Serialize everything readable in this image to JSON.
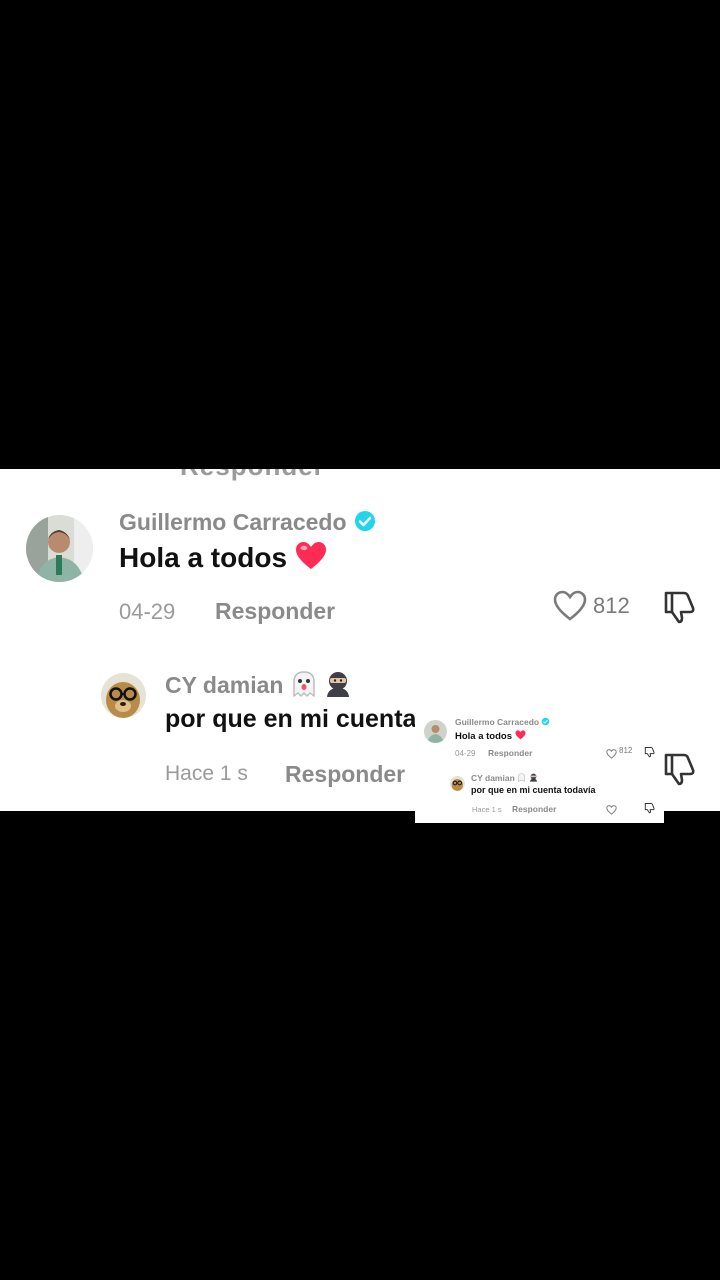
{
  "main": {
    "top_cut_text": "Responder",
    "comments": [
      {
        "username": "Guillermo Carracedo",
        "verified": true,
        "text": "Hola a todos",
        "text_emoji": "heart-icon",
        "date": "04-29",
        "reply_label": "Responder",
        "like_count": "812"
      },
      {
        "username": "CY damian",
        "name_emojis": [
          "ghost-icon",
          "ninja-icon"
        ],
        "text": "por que en mi cuenta todavía",
        "date": "Hace 1 s",
        "reply_label": "Responder"
      }
    ]
  },
  "overlay": {
    "comments": [
      {
        "username": "Guillermo Carracedo",
        "text": "Hola a todos",
        "date": "04-29",
        "reply_label": "Responder",
        "like_count": "812"
      },
      {
        "username": "CY damian",
        "text": "por que en mi cuenta todavía",
        "date": "Hace 1 s",
        "reply_label": "Responder"
      }
    ]
  },
  "colors": {
    "background": "#000000",
    "panel": "#ffffff",
    "verified": "#20d5ec",
    "heart": "#fe2c55",
    "muted": "#8a8a8a"
  }
}
